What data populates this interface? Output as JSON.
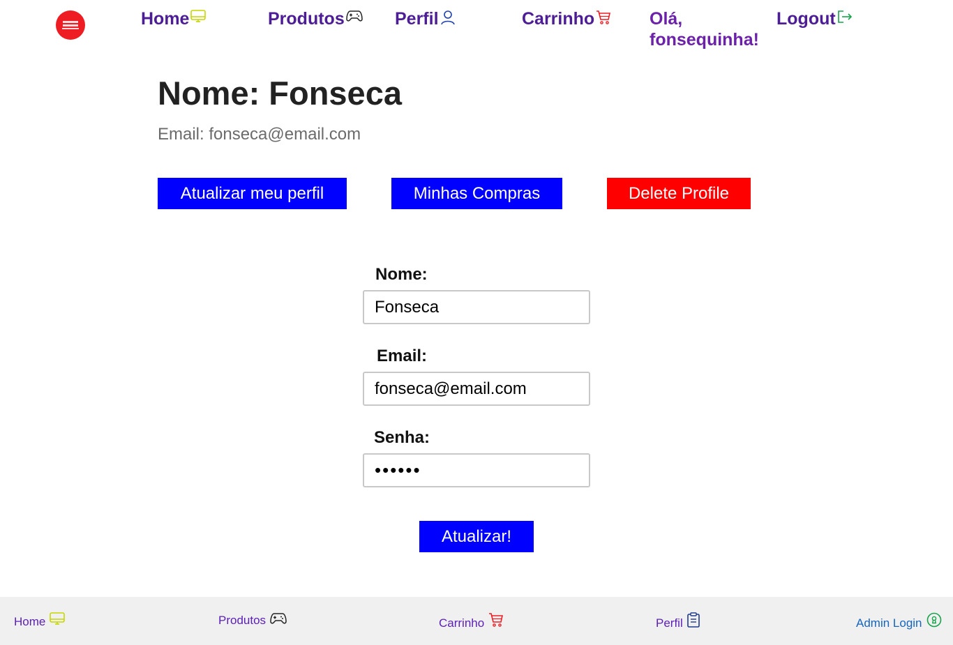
{
  "header": {
    "nav": [
      {
        "label": "Home",
        "icon": "monitor-icon"
      },
      {
        "label": "Produtos",
        "icon": "gamepad-icon"
      },
      {
        "label": "Perfil",
        "icon": "user-icon"
      },
      {
        "label": "Carrinho",
        "icon": "cart-icon"
      },
      {
        "label": "Logout",
        "icon": "logout-icon"
      }
    ],
    "greeting": "Olá, fonsequinha!"
  },
  "profile": {
    "name_line": "Nome: Fonseca",
    "email_line": "Email: fonseca@email.com"
  },
  "actions": {
    "update_profile": "Atualizar meu perfil",
    "my_purchases": "Minhas Compras",
    "delete_profile": "Delete Profile"
  },
  "form": {
    "name_label": "Nome:",
    "name_value": "Fonseca",
    "email_label": "Email:",
    "email_value": "fonseca@email.com",
    "password_label": "Senha:",
    "password_value": "123456",
    "submit_label": "Atualizar!"
  },
  "footer": {
    "links": [
      {
        "label": "Home",
        "icon": "monitor-icon"
      },
      {
        "label": "Produtos",
        "icon": "gamepad-icon"
      },
      {
        "label": "Carrinho",
        "icon": "cart-icon"
      },
      {
        "label": "Perfil",
        "icon": "clipboard-icon"
      },
      {
        "label": "Admin Login",
        "icon": "keyhole-icon"
      }
    ]
  },
  "colors": {
    "nav_text": "#4c1d95",
    "primary_button": "#0000ff",
    "danger_button": "#ff0000",
    "logo": "#ee1d23",
    "footer_bg": "#f0f0f0"
  }
}
